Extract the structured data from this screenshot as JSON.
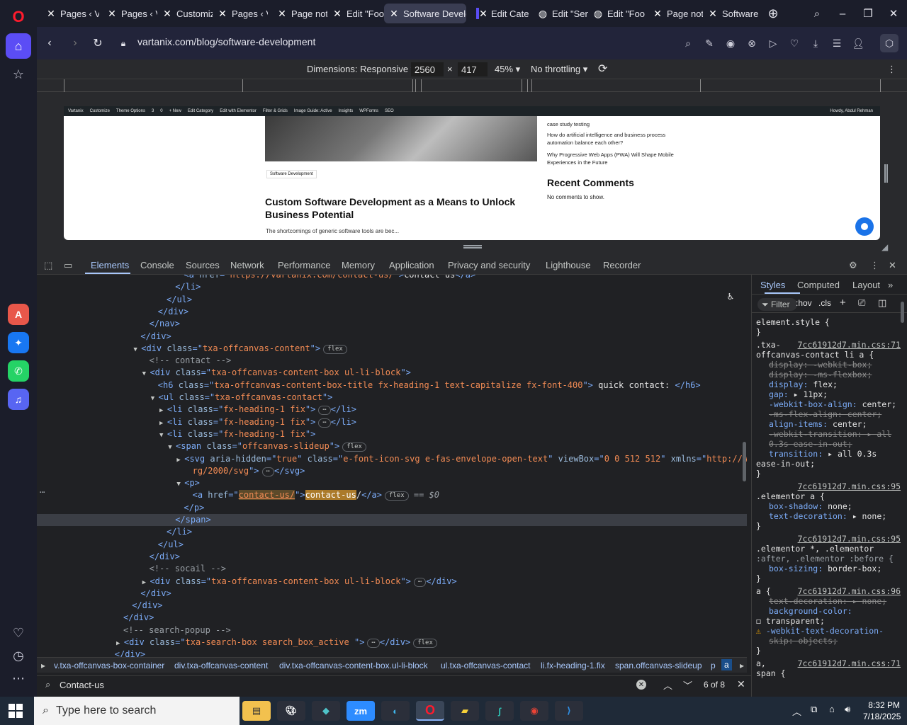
{
  "browser": {
    "tabs": [
      {
        "label": "Pages ‹ V",
        "icon": "x-icon"
      },
      {
        "label": "Pages ‹ V",
        "icon": "x-icon"
      },
      {
        "label": "Customiz",
        "icon": "x-icon"
      },
      {
        "label": "Pages ‹ V",
        "icon": "x-icon"
      },
      {
        "label": "Page not",
        "icon": "x-icon"
      },
      {
        "label": "Edit \"Foo",
        "icon": "x-icon"
      },
      {
        "label": "Software Develo",
        "icon": "x-icon"
      },
      {
        "label": "Edit Cate",
        "icon": "x-icon"
      },
      {
        "label": "Edit \"Sen",
        "icon": "globe-icon"
      },
      {
        "label": "Edit \"Foo",
        "icon": "globe-icon"
      },
      {
        "label": "Page not",
        "icon": "x-icon"
      },
      {
        "label": "Software",
        "icon": "x-icon"
      }
    ],
    "url": "vartanix.com/blog/software-development"
  },
  "device_toolbar": {
    "dimensions_label": "Dimensions: Responsive",
    "width": "2560",
    "height": "417",
    "zoom": "45%",
    "throttling": "No throttling",
    "times": "×"
  },
  "site": {
    "admin_bar": [
      "Vartanix",
      "Customize",
      "Theme Options",
      "3",
      "0",
      "+ New",
      "Edit Category",
      "Edit with Elementor",
      "Filter & Grids",
      "Image Guide: Active",
      "Insights",
      "WPForms",
      "SEO",
      "Howdy, Abdul Rehman"
    ],
    "category": "Software Development",
    "post_title": "Custom Software Development as a Means to Unlock Business Potential",
    "post_excerpt": "The shortcomings of generic software tools are bec...",
    "side_links": [
      "case study testing",
      "How do artificial intelligence and business process automation balance each other?",
      "Why Progressive Web Apps (PWA) Will Shape Mobile Experiences in the Future"
    ],
    "recent_comments_title": "Recent Comments",
    "recent_comments_empty": "No comments to show."
  },
  "devtools": {
    "tabs": [
      "Elements",
      "Console",
      "Sources",
      "Network",
      "Performance",
      "Memory",
      "Application",
      "Privacy and security",
      "Lighthouse",
      "Recorder"
    ],
    "styles_tabs": [
      "Styles",
      "Computed",
      "Layout"
    ],
    "filter_placeholder": "Filter",
    "hov": ":hov",
    "cls": ".cls",
    "dom_lines": [
      {
        "indent": 17,
        "parts": [
          [
            "tg",
            "<a "
          ],
          [
            "at",
            "href"
          ],
          [
            "tg",
            "=\""
          ],
          [
            "av",
            "https://vartanix.com/contact-us/"
          ],
          [
            "tg",
            "\">"
          ],
          [
            "tx",
            "contact us"
          ],
          [
            "tg",
            "</a>"
          ]
        ]
      },
      {
        "indent": 16,
        "parts": [
          [
            "tg",
            "</li>"
          ]
        ]
      },
      {
        "indent": 15,
        "parts": [
          [
            "tg",
            "</ul>"
          ]
        ]
      },
      {
        "indent": 14,
        "parts": [
          [
            "tg",
            "</div>"
          ]
        ]
      },
      {
        "indent": 13,
        "parts": [
          [
            "tg",
            "</nav>"
          ]
        ]
      },
      {
        "indent": 12,
        "parts": [
          [
            "tg",
            "</div>"
          ]
        ]
      },
      {
        "indent": 12,
        "arrow": "▼",
        "parts": [
          [
            "tg",
            "<div "
          ],
          [
            "at",
            "class"
          ],
          [
            "tg",
            "=\""
          ],
          [
            "av",
            "txa-offcanvas-content"
          ],
          [
            "tg",
            "\">"
          ]
        ],
        "badge": "flex"
      },
      {
        "indent": 13,
        "parts": [
          [
            "cm",
            "<!-- contact -->"
          ]
        ]
      },
      {
        "indent": 13,
        "arrow": "▼",
        "parts": [
          [
            "tg",
            "<div "
          ],
          [
            "at",
            "class"
          ],
          [
            "tg",
            "=\""
          ],
          [
            "av",
            "txa-offcanvas-content-box  ul-li-block"
          ],
          [
            "tg",
            "\">"
          ]
        ]
      },
      {
        "indent": 14,
        "parts": [
          [
            "tg",
            "<h6 "
          ],
          [
            "at",
            "class"
          ],
          [
            "tg",
            "=\""
          ],
          [
            "av",
            "txa-offcanvas-content-box-title fx-heading-1 text-capitalize fx-font-400"
          ],
          [
            "tg",
            "\">"
          ],
          [
            "tx",
            " quick contact: "
          ],
          [
            "tg",
            "</h6>"
          ]
        ]
      },
      {
        "indent": 14,
        "arrow": "▼",
        "parts": [
          [
            "tg",
            "<ul "
          ],
          [
            "at",
            "class"
          ],
          [
            "tg",
            "=\""
          ],
          [
            "av",
            "txa-offcanvas-contact"
          ],
          [
            "tg",
            "\">"
          ]
        ]
      },
      {
        "indent": 15,
        "arrow": "▶",
        "parts": [
          [
            "tg",
            "<li "
          ],
          [
            "at",
            "class"
          ],
          [
            "tg",
            "=\""
          ],
          [
            "av",
            "fx-heading-1 fix"
          ],
          [
            "tg",
            "\">"
          ],
          [
            "badge",
            "⋯"
          ],
          [
            "tg",
            "</li>"
          ]
        ]
      },
      {
        "indent": 15,
        "arrow": "▶",
        "parts": [
          [
            "tg",
            "<li "
          ],
          [
            "at",
            "class"
          ],
          [
            "tg",
            "=\""
          ],
          [
            "av",
            "fx-heading-1 fix"
          ],
          [
            "tg",
            "\">"
          ],
          [
            "badge",
            "⋯"
          ],
          [
            "tg",
            "</li>"
          ]
        ]
      },
      {
        "indent": 15,
        "arrow": "▼",
        "parts": [
          [
            "tg",
            "<li "
          ],
          [
            "at",
            "class"
          ],
          [
            "tg",
            "=\""
          ],
          [
            "av",
            "fx-heading-1 fix"
          ],
          [
            "tg",
            "\">"
          ]
        ]
      },
      {
        "indent": 16,
        "arrow": "▼",
        "parts": [
          [
            "tg",
            "<span "
          ],
          [
            "at",
            "class"
          ],
          [
            "tg",
            "=\""
          ],
          [
            "av",
            "offcanvas-slideup"
          ],
          [
            "tg",
            "\">"
          ]
        ],
        "badge": "flex"
      },
      {
        "indent": 17,
        "arrow": "▶",
        "parts": [
          [
            "tg",
            "<svg "
          ],
          [
            "at",
            "aria-hidden"
          ],
          [
            "tg",
            "=\""
          ],
          [
            "av",
            "true"
          ],
          [
            "tg",
            "\" "
          ],
          [
            "at",
            "class"
          ],
          [
            "tg",
            "=\""
          ],
          [
            "av",
            "e-font-icon-svg e-fas-envelope-open-text"
          ],
          [
            "tg",
            "\" "
          ],
          [
            "at",
            "viewBox"
          ],
          [
            "tg",
            "=\""
          ],
          [
            "av",
            "0 0 512 512"
          ],
          [
            "tg",
            "\" "
          ],
          [
            "at",
            "xmlns"
          ],
          [
            "tg",
            "=\""
          ],
          [
            "av",
            "http://www.w3.o"
          ]
        ]
      },
      {
        "indent": 18,
        "parts": [
          [
            "av",
            "rg/2000/svg"
          ],
          [
            "tg",
            "\">"
          ],
          [
            "badge",
            "⋯"
          ],
          [
            "tg",
            "</svg>"
          ]
        ]
      },
      {
        "indent": 17,
        "arrow": "▼",
        "parts": [
          [
            "tg",
            "<p>"
          ]
        ]
      },
      {
        "indent": 18,
        "sel": true,
        "parts": [
          [
            "tg",
            "<a "
          ],
          [
            "at",
            "href"
          ],
          [
            "tg",
            "=\""
          ],
          [
            "hlv",
            "contact-us/"
          ],
          [
            "tg",
            "\">"
          ],
          [
            "hl",
            "contact-us"
          ],
          [
            "tx",
            "/"
          ],
          [
            "tg",
            "</a>"
          ]
        ],
        "badge": "flex",
        "suffix": " == $0"
      },
      {
        "indent": 17,
        "parts": [
          [
            "tg",
            "</p>"
          ]
        ]
      },
      {
        "indent": 16,
        "parts": [
          [
            "tg",
            "</span>"
          ]
        ],
        "selbg": true
      },
      {
        "indent": 15,
        "parts": [
          [
            "tg",
            "</li>"
          ]
        ]
      },
      {
        "indent": 14,
        "parts": [
          [
            "tg",
            "</ul>"
          ]
        ]
      },
      {
        "indent": 13,
        "parts": [
          [
            "tg",
            "</div>"
          ]
        ]
      },
      {
        "indent": 13,
        "parts": [
          [
            "cm",
            "<!-- socail -->"
          ]
        ]
      },
      {
        "indent": 13,
        "arrow": "▶",
        "parts": [
          [
            "tg",
            "<div "
          ],
          [
            "at",
            "class"
          ],
          [
            "tg",
            "=\""
          ],
          [
            "av",
            "txa-offcanvas-content-box ul-li-block"
          ],
          [
            "tg",
            "\">"
          ],
          [
            "badge",
            "⋯"
          ],
          [
            "tg",
            "</div>"
          ]
        ]
      },
      {
        "indent": 12,
        "parts": [
          [
            "tg",
            "</div>"
          ]
        ]
      },
      {
        "indent": 11,
        "parts": [
          [
            "tg",
            "</div>"
          ]
        ]
      },
      {
        "indent": 10,
        "parts": [
          [
            "tg",
            "</div>"
          ]
        ]
      },
      {
        "indent": 10,
        "parts": [
          [
            "cm",
            "<!-- search-popup -->"
          ]
        ]
      },
      {
        "indent": 10,
        "arrow": "▶",
        "parts": [
          [
            "tg",
            "<div "
          ],
          [
            "at",
            "class"
          ],
          [
            "tg",
            "=\""
          ],
          [
            "av",
            "txa-search-box search_box_active "
          ],
          [
            "tg",
            "\">"
          ],
          [
            "badge",
            "⋯"
          ],
          [
            "tg",
            "</div>"
          ]
        ],
        "badge": "flex"
      },
      {
        "indent": 9,
        "parts": [
          [
            "tg",
            "</div>"
          ]
        ]
      }
    ],
    "styles": [
      {
        "t": "sel",
        "text": "element.style {"
      },
      {
        "t": "sel",
        "text": "}"
      },
      {
        "t": "rule",
        "sel": ".txa-",
        "src": "7cc61912d7.min.css:71"
      },
      {
        "t": "sel",
        "text": "offcanvas-contact li a {"
      },
      {
        "t": "pstrike",
        "text": "display: -webkit-box;"
      },
      {
        "t": "pstrike",
        "text": "display: -ms-flexbox;"
      },
      {
        "t": "p",
        "prop": "display",
        "val": "flex;"
      },
      {
        "t": "p",
        "prop": "gap",
        "val": "▸ 11px;"
      },
      {
        "t": "p",
        "prop": "-webkit-box-align",
        "val": "center;"
      },
      {
        "t": "pstrike",
        "text": "-ms-flex-align: center;"
      },
      {
        "t": "p",
        "prop": "align-items",
        "val": "center;"
      },
      {
        "t": "pstrike",
        "text": "-webkit-transition: ▸ all"
      },
      {
        "t": "pstrike",
        "text": "  0.3s ease-in-out;"
      },
      {
        "t": "p",
        "prop": "transition",
        "val": "▸ all 0.3s"
      },
      {
        "t": "val",
        "text": "    ease-in-out;"
      },
      {
        "t": "sel",
        "text": "}"
      },
      {
        "t": "rule",
        "sel": "",
        "src": "7cc61912d7.min.css:95"
      },
      {
        "t": "sel",
        "text": ".elementor a {"
      },
      {
        "t": "p",
        "prop": "box-shadow",
        "val": "none;"
      },
      {
        "t": "p",
        "prop": "text-decoration",
        "val": "▸ none;"
      },
      {
        "t": "sel",
        "text": "}"
      },
      {
        "t": "rule",
        "sel": "",
        "src": "7cc61912d7.min.css:95"
      },
      {
        "t": "sel",
        "text": ".elementor *, .elementor"
      },
      {
        "t": "selgray",
        "text": ":after, .elementor :before {"
      },
      {
        "t": "p",
        "prop": "box-sizing",
        "val": "border-box;"
      },
      {
        "t": "sel",
        "text": "}"
      },
      {
        "t": "rule",
        "sel": "a {",
        "src": "7cc61912d7.min.css:96"
      },
      {
        "t": "pstrike",
        "text": "text-decoration: ▸ none;"
      },
      {
        "t": "p",
        "prop": "background-color",
        "val": ""
      },
      {
        "t": "val",
        "text": "    ◻ transparent;"
      },
      {
        "t": "pwarn",
        "text": "-webkit-text-decoration-"
      },
      {
        "t": "pstrike2",
        "text": "    skip: objects;"
      },
      {
        "t": "sel",
        "text": "}"
      },
      {
        "t": "rule",
        "sel": "a,",
        "src": "7cc61912d7.min.css:71"
      },
      {
        "t": "sel",
        "text": "span {"
      }
    ],
    "breadcrumbs": [
      "▸",
      "v.txa-offcanvas-box-container",
      "div.txa-offcanvas-content",
      "div.txa-offcanvas-content-box.ul-li-block",
      "ul.txa-offcanvas-contact",
      "li.fx-heading-1.fix",
      "span.offcanvas-slideup",
      "p",
      "a"
    ],
    "find_query": "Contact-us",
    "find_count": "6 of 8"
  },
  "taskbar": {
    "search_placeholder": "Type here to search",
    "time": "8:32 PM",
    "date": "7/18/2025"
  },
  "colors": {
    "opera_red": "#ff1b2d",
    "devtools_accent": "#a8c7fa",
    "highlight": "#ab7a2a"
  }
}
